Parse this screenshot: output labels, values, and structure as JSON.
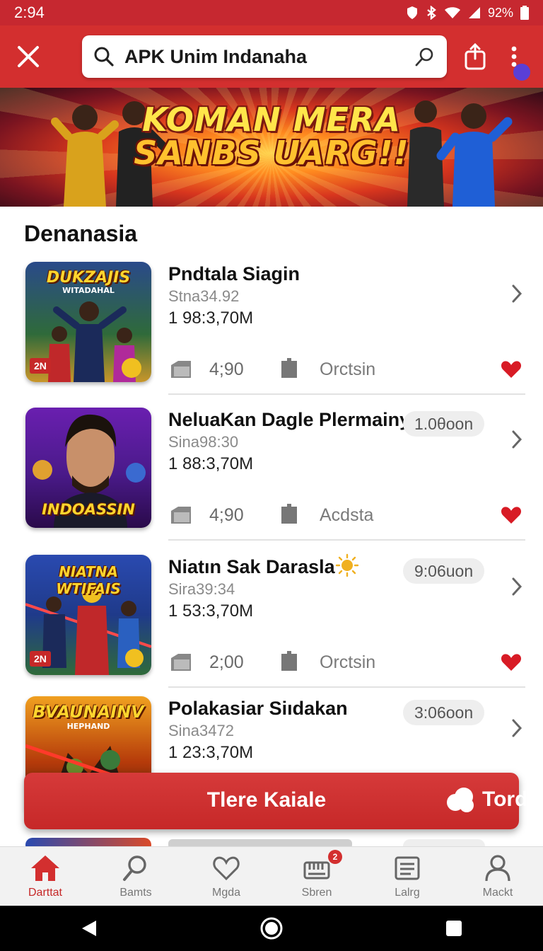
{
  "status_bar": {
    "time": "2:94",
    "battery": "92%"
  },
  "app_bar": {
    "search_query": "APK Unim Indanaha"
  },
  "banner": {
    "line1": "KOMAN MERA",
    "line2": "SANBS UARG!!"
  },
  "section": {
    "title": "Denanasia"
  },
  "games": [
    {
      "thumb_title": "DUKZAJIS",
      "thumb_subtitle": "WITADAHAL",
      "thumb_badge": "2N",
      "name": "Pndtala Siagin",
      "pill": "",
      "sub": "Stna34.92",
      "stat": "1 98:3,70M",
      "rating": "4;90",
      "tag": "Orctsin",
      "colors": {
        "bg1": "#2f6a3a",
        "bg2": "#c9962a"
      }
    },
    {
      "thumb_title": "INDOASSIN",
      "thumb_subtitle": "",
      "thumb_badge": "",
      "name": "NeluaKan Dagle Plermainy",
      "pill": "1.0θoon",
      "sub": "Sina98:30",
      "stat": "1 88:3,70M",
      "rating": "4;90",
      "tag": "Acdsta",
      "colors": {
        "bg1": "#5a1a9a",
        "bg2": "#b04ad0"
      }
    },
    {
      "thumb_title": "NIATNA WTIFAIS",
      "thumb_subtitle": "",
      "thumb_badge": "2N",
      "name": "Niatın Sak Darasla",
      "pill": "9:06uon",
      "sub": "Sira39:34",
      "stat": "1 53:3,70M",
      "rating": "2;00",
      "tag": "Orctsin",
      "colors": {
        "bg1": "#1f4a9a",
        "bg2": "#d9502a"
      }
    },
    {
      "thumb_title": "BVAUNAINV",
      "thumb_subtitle": "HEPHAND",
      "thumb_badge": "",
      "name": "Polakasiar Siıdakan",
      "pill": "3:06oon",
      "sub": "Sina3472",
      "stat": "1 23:3,70M",
      "rating": "",
      "tag": "",
      "colors": {
        "bg1": "#b53a0a",
        "bg2": "#f0a020"
      }
    }
  ],
  "cta": {
    "label": "Tlere Kaiale",
    "right_label": "Tord"
  },
  "bottom_nav": [
    {
      "label": "Darttat",
      "icon": "home-icon"
    },
    {
      "label": "Bamts",
      "icon": "search-icon"
    },
    {
      "label": "Mgda",
      "icon": "heart-icon"
    },
    {
      "label": "Sbren",
      "icon": "store-icon",
      "badge": "2"
    },
    {
      "label": "Lalrg",
      "icon": "list-icon"
    },
    {
      "label": "Mackt",
      "icon": "profile-icon"
    }
  ],
  "theme": {
    "primary": "#d32f2f",
    "accent": "#c62828",
    "heart": "#d81b25"
  }
}
